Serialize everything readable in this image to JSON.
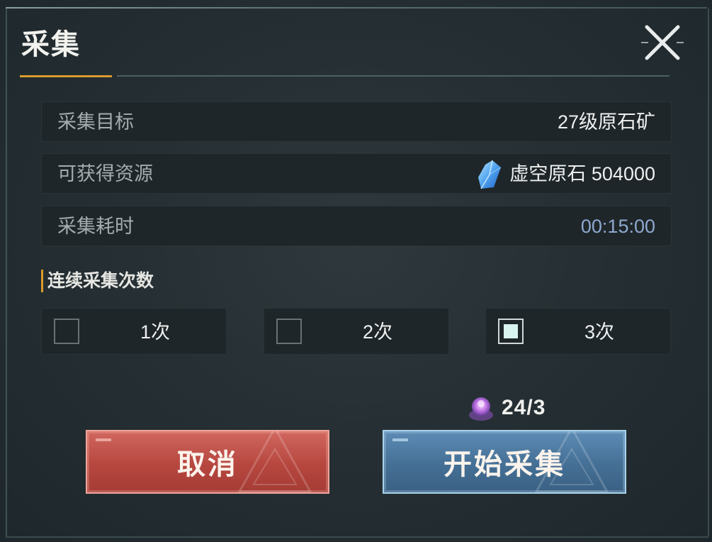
{
  "dialog": {
    "title": "采集",
    "close_icon": "close-icon"
  },
  "info_rows": [
    {
      "label": "采集目标",
      "value": "27级原石矿"
    },
    {
      "label": "可获得资源",
      "value": "虚空原石 504000",
      "icon": "crystal-icon"
    },
    {
      "label": "采集耗时",
      "value": "00:15:00"
    }
  ],
  "repeat": {
    "title": "连续采集次数",
    "options": [
      {
        "label": "1次",
        "checked": false
      },
      {
        "label": "2次",
        "checked": false
      },
      {
        "label": "3次",
        "checked": true
      }
    ]
  },
  "cost": {
    "icon": "stamina-orb-icon",
    "value": "24/3"
  },
  "buttons": {
    "cancel": "取消",
    "start": "开始采集"
  },
  "colors": {
    "accent": "#d99b2d",
    "cancel_button": "#b6473f",
    "start_button": "#456f95",
    "time_text": "#8ea8cf"
  }
}
